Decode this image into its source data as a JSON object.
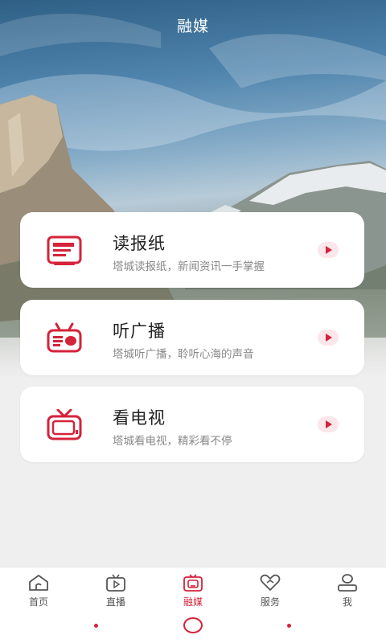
{
  "header": {
    "title": "融媒"
  },
  "cards": [
    {
      "title": "读报纸",
      "desc": "塔城读报纸，新闻资讯一手掌握",
      "icon": "newspaper-icon"
    },
    {
      "title": "听广播",
      "desc": "塔城听广播，聆听心海的声音",
      "icon": "radio-icon"
    },
    {
      "title": "看电视",
      "desc": "塔城看电视，精彩看不停",
      "icon": "tv-icon"
    }
  ],
  "tabbar": {
    "items": [
      {
        "label": "首页",
        "icon": "home-icon",
        "active": false
      },
      {
        "label": "直播",
        "icon": "live-tv-icon",
        "active": false
      },
      {
        "label": "融媒",
        "icon": "media-icon",
        "active": true
      },
      {
        "label": "服务",
        "icon": "heart-service-icon",
        "active": false
      },
      {
        "label": "我",
        "icon": "user-icon",
        "active": false
      }
    ]
  },
  "colors": {
    "accent": "#d4233a",
    "background": "#efefef"
  }
}
